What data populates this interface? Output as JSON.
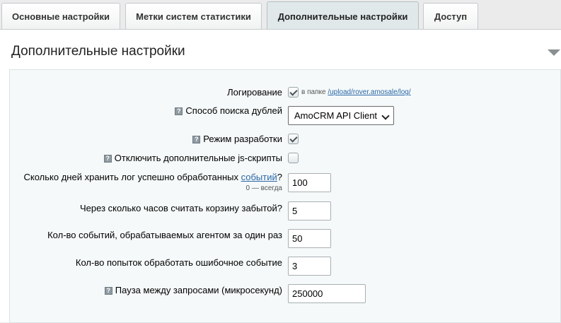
{
  "tabs": [
    {
      "label": "Основные настройки",
      "active": false
    },
    {
      "label": "Метки систем статистики",
      "active": false
    },
    {
      "label": "Дополнительные настройки",
      "active": true
    },
    {
      "label": "Доступ",
      "active": false
    }
  ],
  "section": {
    "title": "Дополнительные настройки"
  },
  "settings": {
    "logging": {
      "label": "Логирование",
      "checked": true,
      "hint_prefix": "в папке",
      "hint_link": "/upload/rover.amosale/log/"
    },
    "duplicate_search": {
      "label": "Способ поиска дублей",
      "selected": "AmoCRM API Client"
    },
    "dev_mode": {
      "label": "Режим разработки",
      "checked": true
    },
    "disable_js": {
      "label": "Отключить дополнительные js-скрипты",
      "checked": false
    },
    "log_days": {
      "label_prefix": "Сколько дней хранить лог успешно обработанных",
      "label_link": "событий",
      "label_suffix": "?",
      "sub_label": "0 — всегда",
      "value": "100"
    },
    "cart_hours": {
      "label": "Через сколько часов считать корзину забытой?",
      "value": "5"
    },
    "agent_events": {
      "label": "Кол-во событий, обрабатываемых агентом за один раз",
      "value": "50"
    },
    "retry_count": {
      "label": "Кол-во попыток обработать ошибочное событие",
      "value": "3"
    },
    "request_pause": {
      "label": "Пауза между запросами (микросекунд)",
      "value": "250000"
    }
  },
  "icons": {
    "help": "?"
  }
}
